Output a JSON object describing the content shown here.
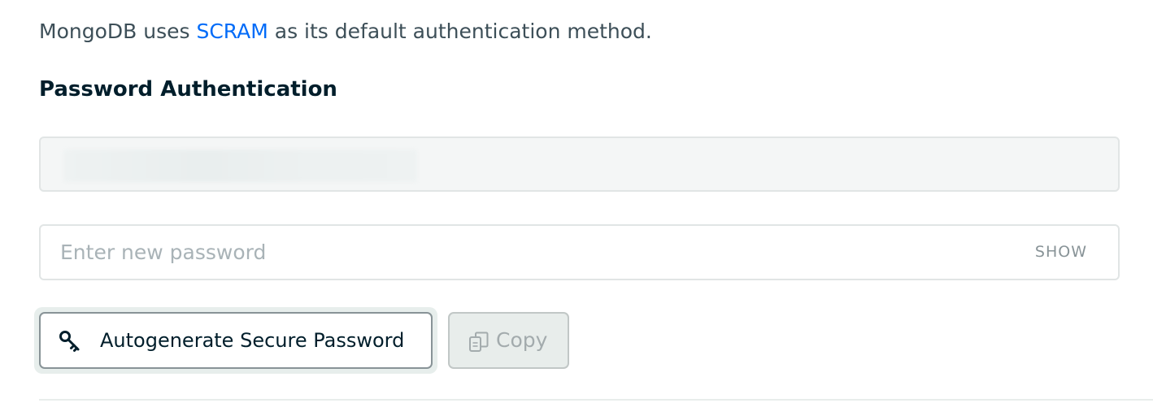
{
  "intro": {
    "prefix": "MongoDB uses ",
    "link": "SCRAM",
    "suffix": " as its default authentication method."
  },
  "section_title": "Password Authentication",
  "username_field": {
    "value": "",
    "redacted": true
  },
  "password_field": {
    "placeholder": "Enter new password",
    "value": "",
    "show_label": "SHOW"
  },
  "buttons": {
    "autogenerate": {
      "label": "Autogenerate Secure Password",
      "icon": "key-icon"
    },
    "copy": {
      "label": "Copy",
      "icon": "copy-icon",
      "disabled": true
    }
  },
  "colors": {
    "link": "#016bf8",
    "heading": "#001e2b",
    "body_text": "#3d4f58"
  }
}
